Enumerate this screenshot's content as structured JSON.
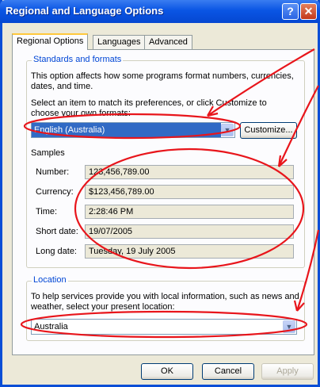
{
  "window": {
    "title": "Regional and Language Options",
    "help_label": "?",
    "close_label": "✕"
  },
  "tabs": [
    {
      "label": "Regional Options"
    },
    {
      "label": "Languages"
    },
    {
      "label": "Advanced"
    }
  ],
  "standards": {
    "group_label": "Standards and formats",
    "description": "This option affects how some programs format numbers, currencies, dates, and time.",
    "instruction": "Select an item to match its preferences, or click Customize to choose your own formats:",
    "selected_format": "English (Australia)",
    "customize_label": "Customize..."
  },
  "samples": {
    "heading": "Samples",
    "rows": [
      {
        "label": "Number:",
        "value": "123,456,789.00"
      },
      {
        "label": "Currency:",
        "value": "$123,456,789.00"
      },
      {
        "label": "Time:",
        "value": "2:28:46 PM"
      },
      {
        "label": "Short date:",
        "value": "19/07/2005"
      },
      {
        "label": "Long date:",
        "value": "Tuesday, 19 July 2005"
      }
    ]
  },
  "location": {
    "group_label": "Location",
    "description": "To help services provide you with local information, such as news and weather, select your present location:",
    "selected": "Australia"
  },
  "footer": {
    "ok_label": "OK",
    "cancel_label": "Cancel",
    "apply_label": "Apply"
  },
  "colors": {
    "annotation": "#e8151b",
    "title_bar": "#0a55e4",
    "selection": "#316ac5"
  }
}
